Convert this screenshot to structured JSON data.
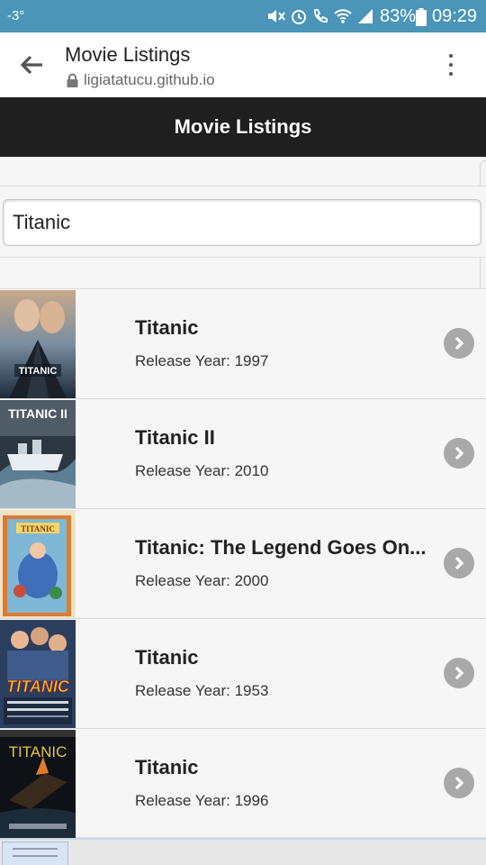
{
  "status_bar": {
    "temperature": "-3°",
    "battery_percent": "83%",
    "time": "09:29",
    "icons": [
      "mute-icon",
      "alarm-icon",
      "call-icon",
      "wifi-icon",
      "signal-icon",
      "battery-icon"
    ]
  },
  "browser": {
    "page_title": "Movie Listings",
    "url": "ligiatatucu.github.io"
  },
  "app_header": {
    "title": "Movie Listings"
  },
  "search": {
    "value": "Titanic"
  },
  "movies": [
    {
      "title": "Titanic",
      "year_label": "Release Year: 1997",
      "poster_text": "TITANIC"
    },
    {
      "title": "Titanic II",
      "year_label": "Release Year: 2010",
      "poster_text": "TITANIC II"
    },
    {
      "title": "Titanic: The Legend Goes On...",
      "year_label": "Release Year: 2000",
      "poster_text": "TITANIC"
    },
    {
      "title": "Titanic",
      "year_label": "Release Year: 1953",
      "poster_text": "TITANIC"
    },
    {
      "title": "Titanic",
      "year_label": "Release Year: 1996",
      "poster_text": "TITANIC"
    }
  ],
  "colors": {
    "status_bar": "#4a95b8",
    "app_header": "#1f1f1f",
    "chevron": "#a9a9a9"
  }
}
